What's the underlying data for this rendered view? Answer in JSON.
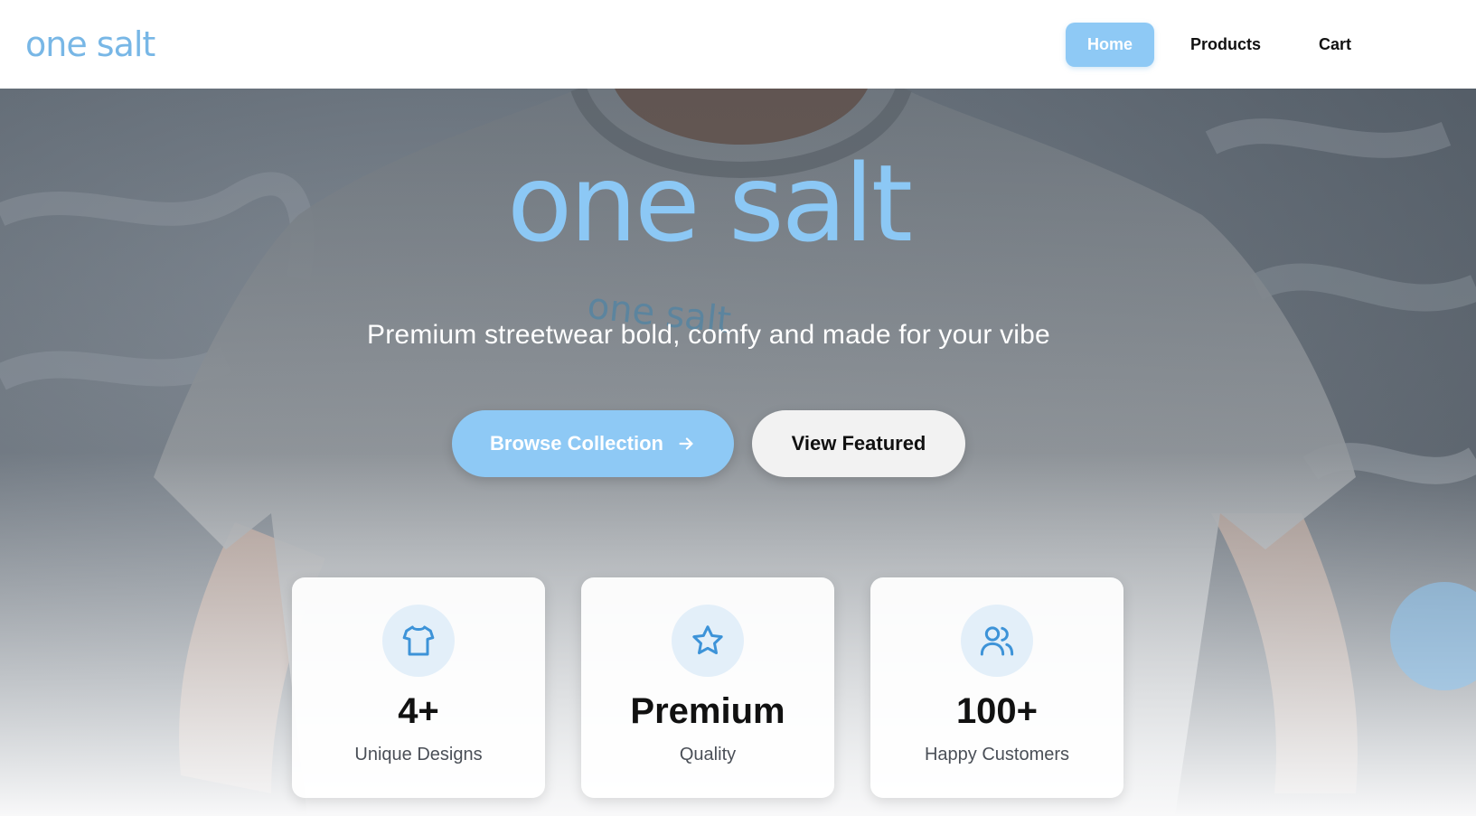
{
  "header": {
    "logo": "one salt",
    "nav": [
      {
        "label": "Home",
        "active": true
      },
      {
        "label": "Products",
        "active": false
      },
      {
        "label": "Cart",
        "active": false
      }
    ]
  },
  "hero": {
    "logo": "one salt",
    "subtitle": "Premium streetwear bold, comfy and made for your vibe",
    "primary_cta": "Browse Collection",
    "secondary_cta": "View Featured"
  },
  "stats": [
    {
      "icon": "tshirt-icon",
      "value": "4+",
      "label": "Unique Designs"
    },
    {
      "icon": "star-icon",
      "value": "Premium",
      "label": "Quality"
    },
    {
      "icon": "users-icon",
      "value": "100+",
      "label": "Happy Customers"
    }
  ],
  "colors": {
    "accent": "#8ec9f5",
    "logo": "#78b7e6",
    "icon": "#3d93d8",
    "icon_bg": "#e3eff9"
  }
}
